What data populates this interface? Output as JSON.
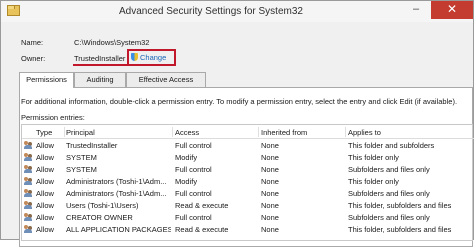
{
  "window": {
    "title": "Advanced Security Settings for System32",
    "minimize": "–",
    "close": "✕"
  },
  "name": {
    "label": "Name:",
    "value": "C:\\Windows\\System32"
  },
  "owner": {
    "label": "Owner:",
    "value": "TrustedInstaller",
    "change_label": "Change"
  },
  "tabs": [
    {
      "label": "Permissions"
    },
    {
      "label": "Auditing"
    },
    {
      "label": "Effective Access"
    }
  ],
  "info_text": "For additional information, double-click a permission entry. To modify a permission entry, select the entry and click Edit (if available).",
  "entries_label": "Permission entries:",
  "columns": [
    "Type",
    "Principal",
    "Access",
    "Inherited from",
    "Applies to"
  ],
  "rows": [
    {
      "type": "Allow",
      "principal": "TrustedInstaller",
      "access": "Full control",
      "inherited": "None",
      "applies": "This folder and subfolders"
    },
    {
      "type": "Allow",
      "principal": "SYSTEM",
      "access": "Modify",
      "inherited": "None",
      "applies": "This folder only"
    },
    {
      "type": "Allow",
      "principal": "SYSTEM",
      "access": "Full control",
      "inherited": "None",
      "applies": "Subfolders and files only"
    },
    {
      "type": "Allow",
      "principal": "Administrators (Toshi-1\\Adm...",
      "access": "Modify",
      "inherited": "None",
      "applies": "This folder only"
    },
    {
      "type": "Allow",
      "principal": "Administrators (Toshi-1\\Adm...",
      "access": "Full control",
      "inherited": "None",
      "applies": "Subfolders and files only"
    },
    {
      "type": "Allow",
      "principal": "Users (Toshi-1\\Users)",
      "access": "Read & execute",
      "inherited": "None",
      "applies": "This folder, subfolders and files"
    },
    {
      "type": "Allow",
      "principal": "CREATOR OWNER",
      "access": "Full control",
      "inherited": "None",
      "applies": "Subfolders and files only"
    },
    {
      "type": "Allow",
      "principal": "ALL APPLICATION PACKAGES",
      "access": "Read & execute",
      "inherited": "None",
      "applies": "This folder, subfolders and files"
    }
  ],
  "colors": {
    "highlight": "#c2182b",
    "link": "#1a66b8",
    "close_button": "#c43c2f"
  },
  "icons": {
    "window": "folder-icon",
    "change": "uac-shield-icon",
    "principal": "users-icon"
  }
}
